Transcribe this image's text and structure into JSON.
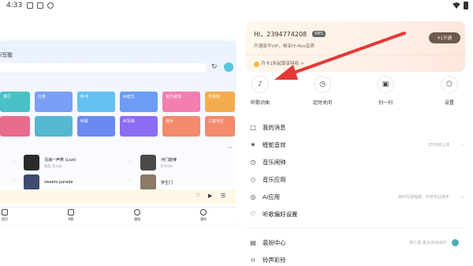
{
  "status_bar": {
    "time": "4:33",
    "icons": [
      "image-icon",
      "notification-icon",
      "key-icon"
    ]
  },
  "background_app": {
    "title": "i写歌",
    "cards": [
      {
        "label": "排行",
        "color": "#49c1c6"
      },
      {
        "label": "分类",
        "color": "#7a9ff5"
      },
      {
        "label": "听书",
        "color": "#63c0f0"
      },
      {
        "label": "AI音乐",
        "color": "#6c9cf5"
      },
      {
        "label": "官方歌单",
        "color": "#f27fb0"
      },
      {
        "label": "乐游戏",
        "color": "#f3ad4e"
      },
      {
        "label": "",
        "color": "#ea6c8c"
      },
      {
        "label": "听歌",
        "color": "#56b8d0"
      },
      {
        "label": "AI写歌",
        "color": "#6a8af0"
      },
      {
        "label": "歌手",
        "color": "#8c6cf2"
      },
      {
        "label": "儿童专区",
        "color": "#f28a6c"
      }
    ],
    "songs": [
      {
        "title": "沿海一声笑 (Live)",
        "artist": "黄霑, 罗大佑",
        "color": "#333"
      },
      {
        "title": "河门旋律",
        "artist": "El Peter",
        "color": "#555"
      },
      {
        "title": "sweets parade",
        "artist": "",
        "color": "#4a5a7a"
      },
      {
        "title": "罗生门",
        "artist": "",
        "color": "#7a6a5a"
      }
    ],
    "tabs": [
      {
        "label": "首页"
      },
      {
        "label": "K歌"
      },
      {
        "label": "漫游"
      },
      {
        "label": "我的"
      }
    ]
  },
  "vip_card": {
    "greeting": "Hi，2394774208",
    "badge": "VIP1",
    "subtitle": "开通豪华VIP，畅享Hi-Res音质",
    "open_button": "¥1开通",
    "promo": "月卡1折起尊享特权 >"
  },
  "quick_actions": [
    {
      "label": "听歌识曲",
      "icon": "music-recognize-icon",
      "glyph": "♪"
    },
    {
      "label": "定时关闭",
      "icon": "clock-icon",
      "glyph": "◷"
    },
    {
      "label": "扫一扫",
      "icon": "scan-icon",
      "glyph": "▣"
    },
    {
      "label": "设置",
      "icon": "settings-icon",
      "glyph": "⬡"
    }
  ],
  "menu": [
    {
      "label": "我的消息",
      "icon": "message-icon",
      "glyph": "□",
      "right": ""
    },
    {
      "label": "蝰蛇音效",
      "icon": "sound-effect-icon",
      "glyph": "✷",
      "right": "3D环绕上线"
    },
    {
      "label": "音乐闹钟",
      "icon": "alarm-icon",
      "glyph": "◷",
      "right": ""
    },
    {
      "label": "音乐应用",
      "icon": "apps-icon",
      "glyph": "◇",
      "right": ""
    },
    {
      "label": "AI应用",
      "icon": "ai-icon",
      "glyph": "◎",
      "right": "用AI写歌唱歌，秒变专业歌手"
    },
    {
      "label": "听歌偏好设置",
      "icon": "preference-icon",
      "glyph": "♡",
      "right": ""
    },
    {
      "label": "装扮中心",
      "icon": "theme-icon",
      "glyph": "▤",
      "right": "罗小黑 夏日泳池派对"
    },
    {
      "label": "铃声彩铃",
      "icon": "ringtone-icon",
      "glyph": "⍾",
      "right": ""
    }
  ],
  "colors": {
    "annotation_arrow": "#e53935",
    "vip_button": "#6b5a4e"
  }
}
